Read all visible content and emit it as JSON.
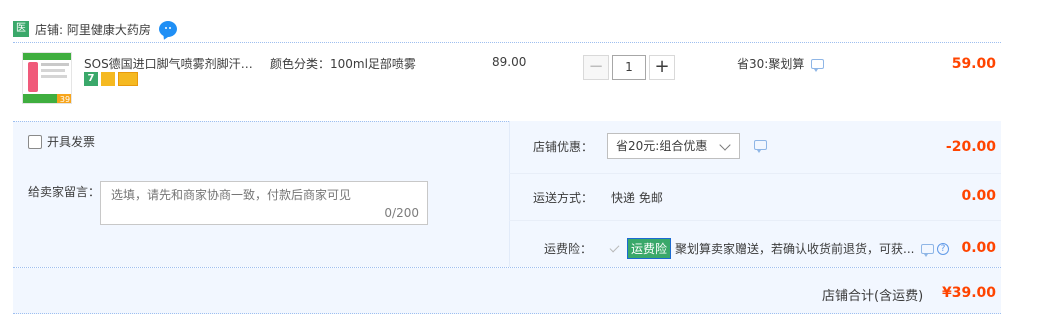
{
  "shop": {
    "badge": "医",
    "name": "店铺: 阿里健康大药房"
  },
  "item": {
    "thumb_tag": "39",
    "title": "SOS德国进口脚气喷雾剂脚汗去...",
    "sku": "颜色分类：100ml足部喷雾",
    "tag_seven": "7",
    "price": "89.00",
    "quantity": "1",
    "minus_label": "−",
    "plus_label": "+",
    "saving": "省30:聚划算",
    "total": "59.00"
  },
  "order": {
    "invoice_label": "开具发票",
    "memo_label": "给卖家留言：",
    "memo_placeholder": "选填，请先和商家协商一致，付款后商家可见",
    "memo_count": "0/200",
    "discount_label": "店铺优惠：",
    "discount_value": "省20元:组合优惠",
    "discount_amount": "-20.00",
    "shipping_label": "运送方式：",
    "shipping_value": "快递 免邮",
    "shipping_amount": "0.00",
    "insurance_label": "运费险：",
    "insurance_tag": "运费险",
    "insurance_text": "聚划算卖家赠送，若确认收货前退货，可获...",
    "insurance_help": "?",
    "insurance_amount": "0.00"
  },
  "footer": {
    "label": "店铺合计(含运费)",
    "total": "¥39.00"
  },
  "colors": {
    "accent": "#ff4400",
    "highlight_bg": "#f2f7ff",
    "badge_green": "#3aa86a",
    "link_blue": "#1f8ff5"
  },
  "icons": {
    "chat": "chat-bubble-icon",
    "message": "message-icon",
    "help": "help-icon",
    "chevron": "chevron-down-icon"
  }
}
